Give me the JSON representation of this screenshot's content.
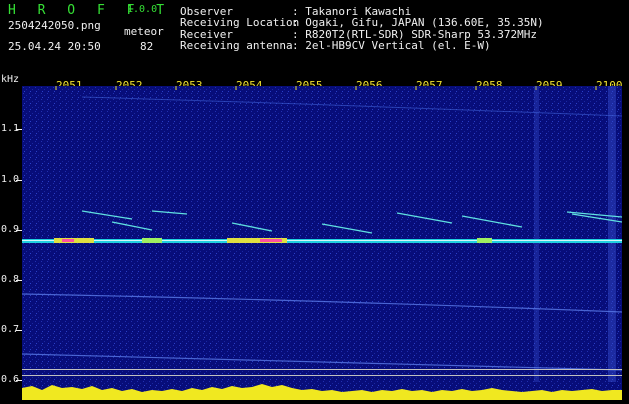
{
  "app": {
    "logo": "H R O F F T",
    "version": "1.0.0"
  },
  "capture": {
    "filename": "2504242050.png",
    "datetime": "25.04.24 20:50",
    "detector_label": "meteor",
    "count": "82"
  },
  "info": {
    "labels": [
      "Observer",
      "Receiving Location",
      "Receiver",
      "Receiving antenna"
    ],
    "values": [
      ": Takanori Kawachi",
      ": Ogaki, Gifu, JAPAN (136.60E, 35.35N)",
      ": R820T2(RTL-SDR) SDR-Sharp 53.372MHz",
      ": 2el-HB9CV Vertical (el. E-W)"
    ]
  },
  "y_axis": {
    "unit": "kHz",
    "ticks": [
      "1.1",
      "1.0",
      "0.9",
      "0.8",
      "0.7",
      "0.6"
    ]
  },
  "x_axis": {
    "ticks": [
      "2051",
      "2052",
      "2053",
      "2054",
      "2055",
      "2056",
      "2057",
      "2058",
      "2059",
      "2100"
    ]
  },
  "colors": {
    "background": "#000000",
    "spectrum_bg": "#070d7a",
    "label_green": "#35e035",
    "label_yellow": "#f0e030",
    "text_white": "#f0f0f0"
  }
}
